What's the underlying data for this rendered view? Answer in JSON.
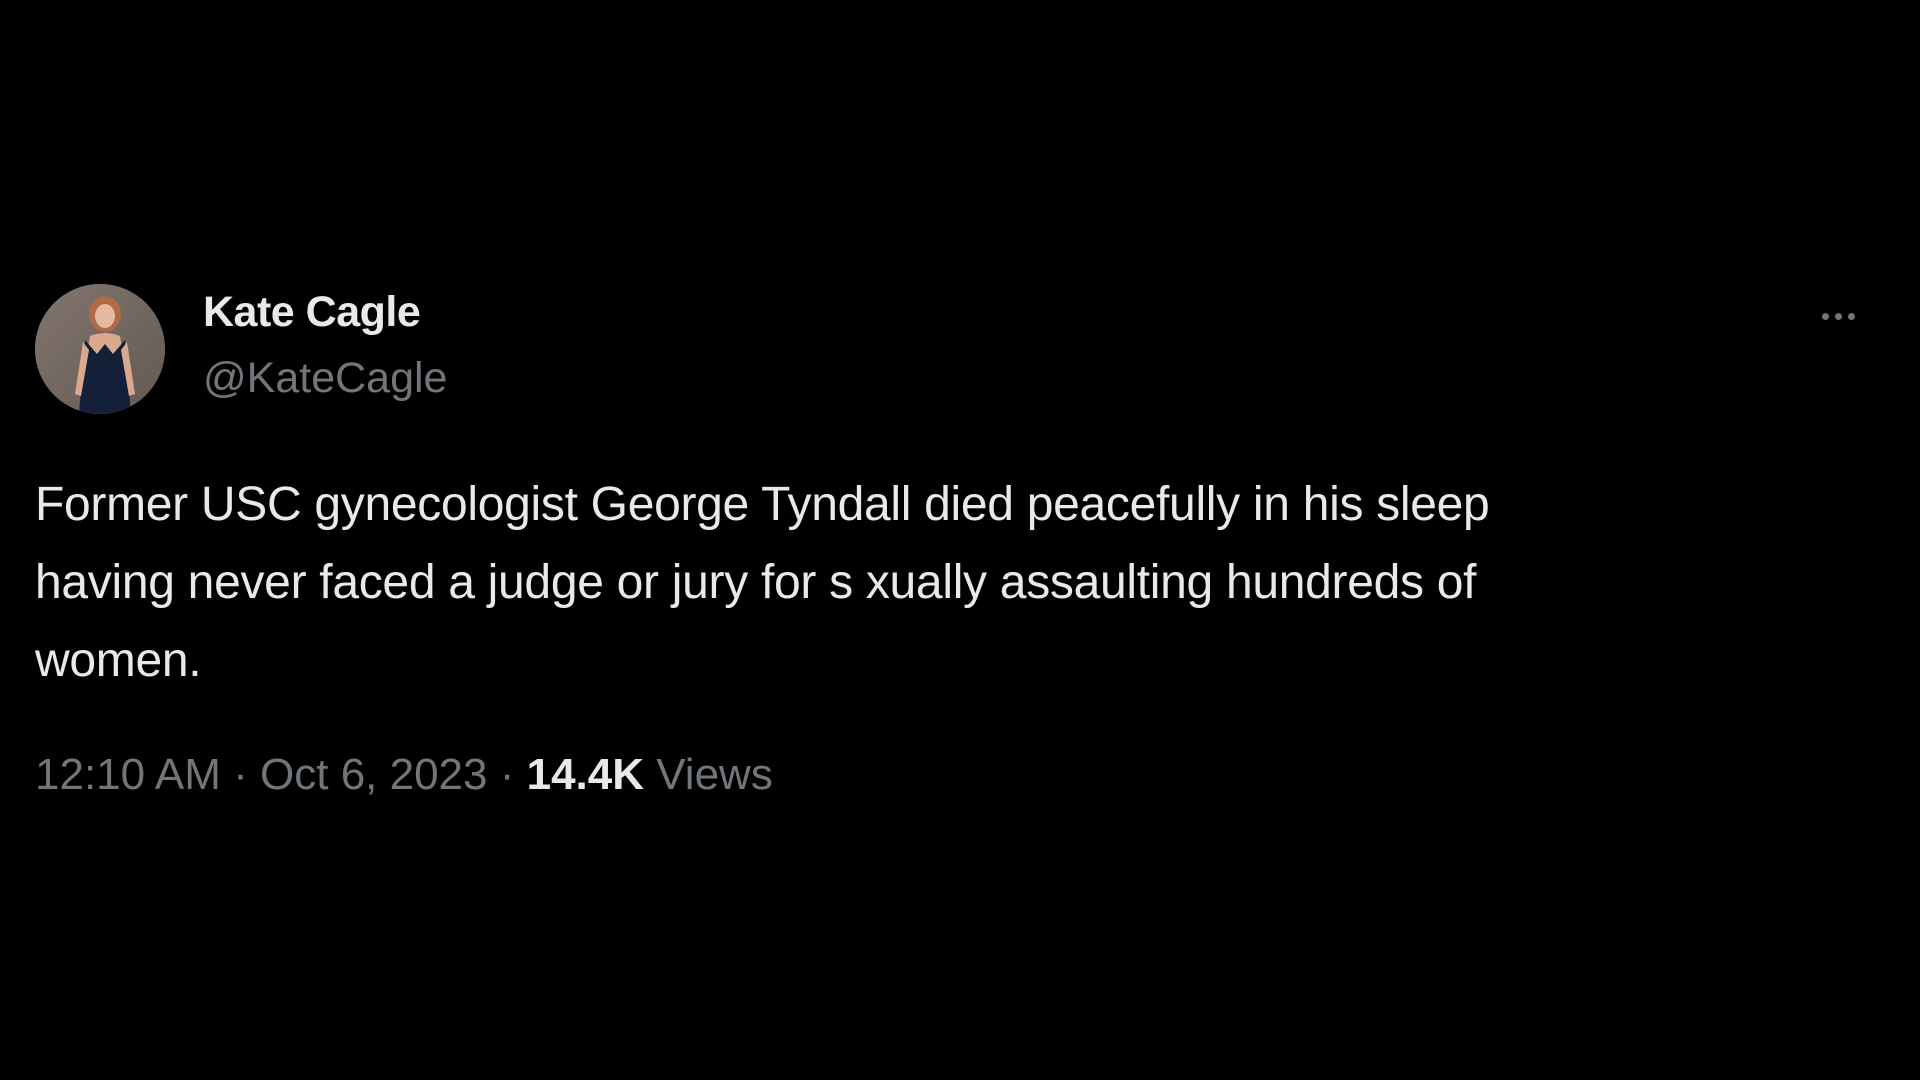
{
  "author": {
    "display_name": "Kate Cagle",
    "handle": "@KateCagle"
  },
  "tweet": {
    "text_lines": [
      "Former USC gynecologist George Tyndall died peacefully in his sleep",
      "having never faced a judge or jury for s   xually assaulting hundreds of",
      "women."
    ]
  },
  "meta": {
    "time": "12:10 AM",
    "separator1": " · ",
    "date": "Oct 6, 2023",
    "separator2": " · ",
    "views_count": "14.4K",
    "views_label": " Views"
  },
  "icons": {
    "more": "more-horizontal-icon"
  },
  "colors": {
    "background": "#000000",
    "primary_text": "#e7e9ea",
    "secondary_text": "#71767b"
  }
}
